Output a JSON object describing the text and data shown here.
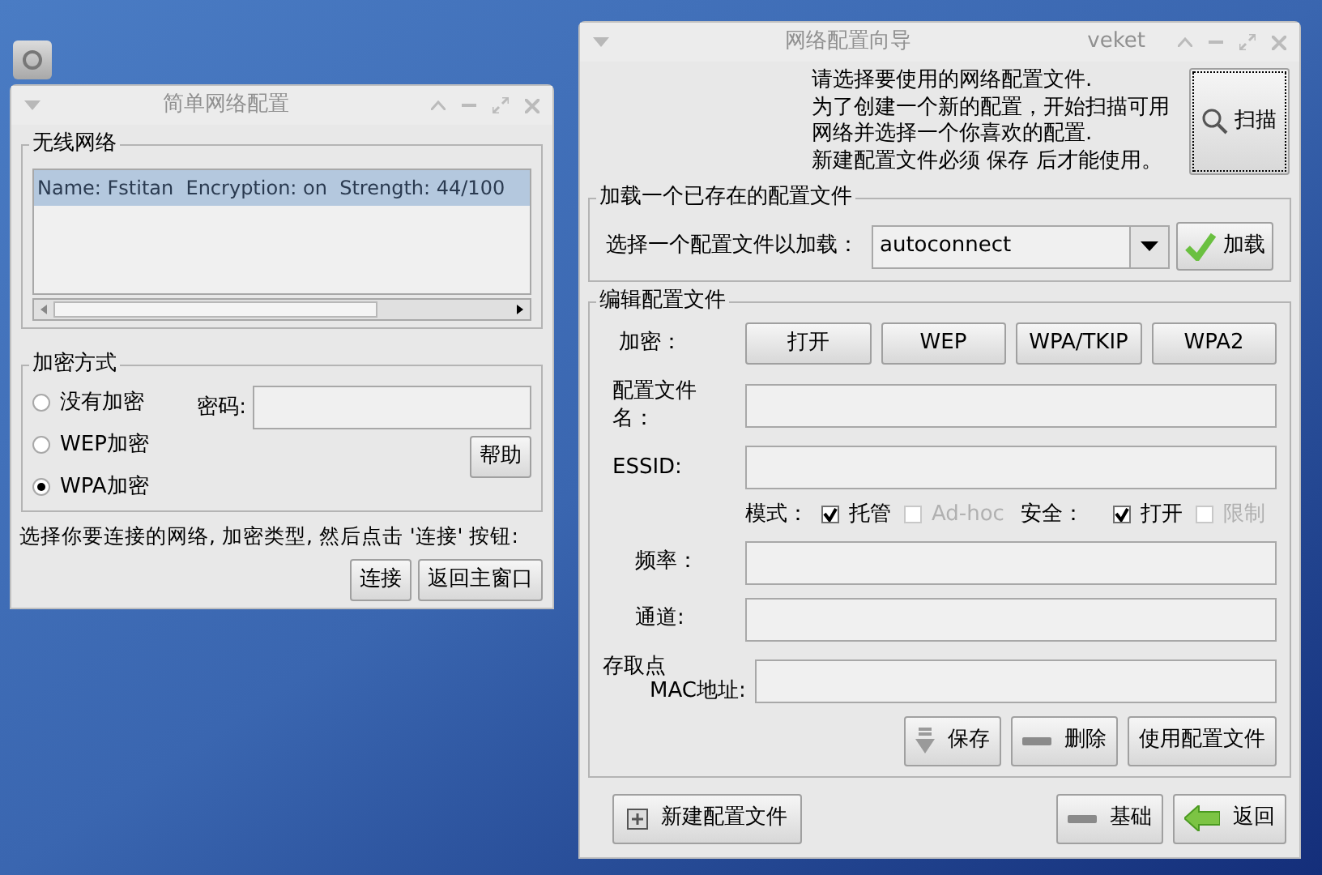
{
  "left_window": {
    "title": "简单网络配置",
    "wireless": {
      "title": "无线网络",
      "networks": [
        {
          "text": "Name: Fstitan  Encryption: on  Strength: 44/100",
          "selected": true
        }
      ]
    },
    "encryption": {
      "title": "加密方式",
      "options": [
        {
          "label": "没有加密",
          "selected": false
        },
        {
          "label": "WEP加密",
          "selected": false
        },
        {
          "label": "WPA加密",
          "selected": true
        }
      ],
      "password_label": "密码:",
      "help_button": "帮助"
    },
    "instruction": "选择你要连接的网络, 加密类型, 然后点击 '连接' 按钮:",
    "buttons": [
      "连接",
      "返回主窗口"
    ]
  },
  "right_window": {
    "title": "网络配置向导",
    "user": "veket",
    "intro": [
      "请选择要使用的网络配置文件.",
      "为了创建一个新的配置，开始扫描可用",
      "网络并选择一个你喜欢的配置.",
      "新建配置文件必须 保存 后才能使用。"
    ],
    "scan_button": "扫描",
    "load_group": {
      "title": "加载一个已存在的配置文件",
      "label": "选择一个配置文件以加载：",
      "select_value": "autoconnect",
      "load_button": "加载"
    },
    "edit_group": {
      "title": "编辑配置文件",
      "encryption_label": "加密：",
      "encryption_buttons": [
        "打开",
        "WEP",
        "WPA/TKIP",
        "WPA2"
      ],
      "fields_top": [
        {
          "label": "配置文件名："
        },
        {
          "label": "ESSID:"
        }
      ],
      "mode_label": "模式：",
      "mode_options": [
        {
          "label": "托管",
          "checked": true,
          "disabled": false
        },
        {
          "label": "Ad-hoc",
          "checked": false,
          "disabled": true
        }
      ],
      "security_label": "安全：",
      "security_options": [
        {
          "label": "打开",
          "checked": true,
          "disabled": false
        },
        {
          "label": "限制",
          "checked": false,
          "disabled": true
        }
      ],
      "fields_bottom": [
        {
          "label": "频率："
        },
        {
          "label": "通道:"
        }
      ],
      "mac_label_1": "存取点",
      "mac_label_2": "MAC地址:",
      "actions": [
        {
          "kind": "save",
          "label": "保存"
        },
        {
          "kind": "delete",
          "label": "删除"
        },
        {
          "kind": "plain",
          "label": "使用配置文件"
        }
      ]
    },
    "new_button": "新建配置文件",
    "footer_buttons": [
      {
        "kind": "basic",
        "label": "基础"
      },
      {
        "kind": "back",
        "label": "返回"
      }
    ]
  }
}
